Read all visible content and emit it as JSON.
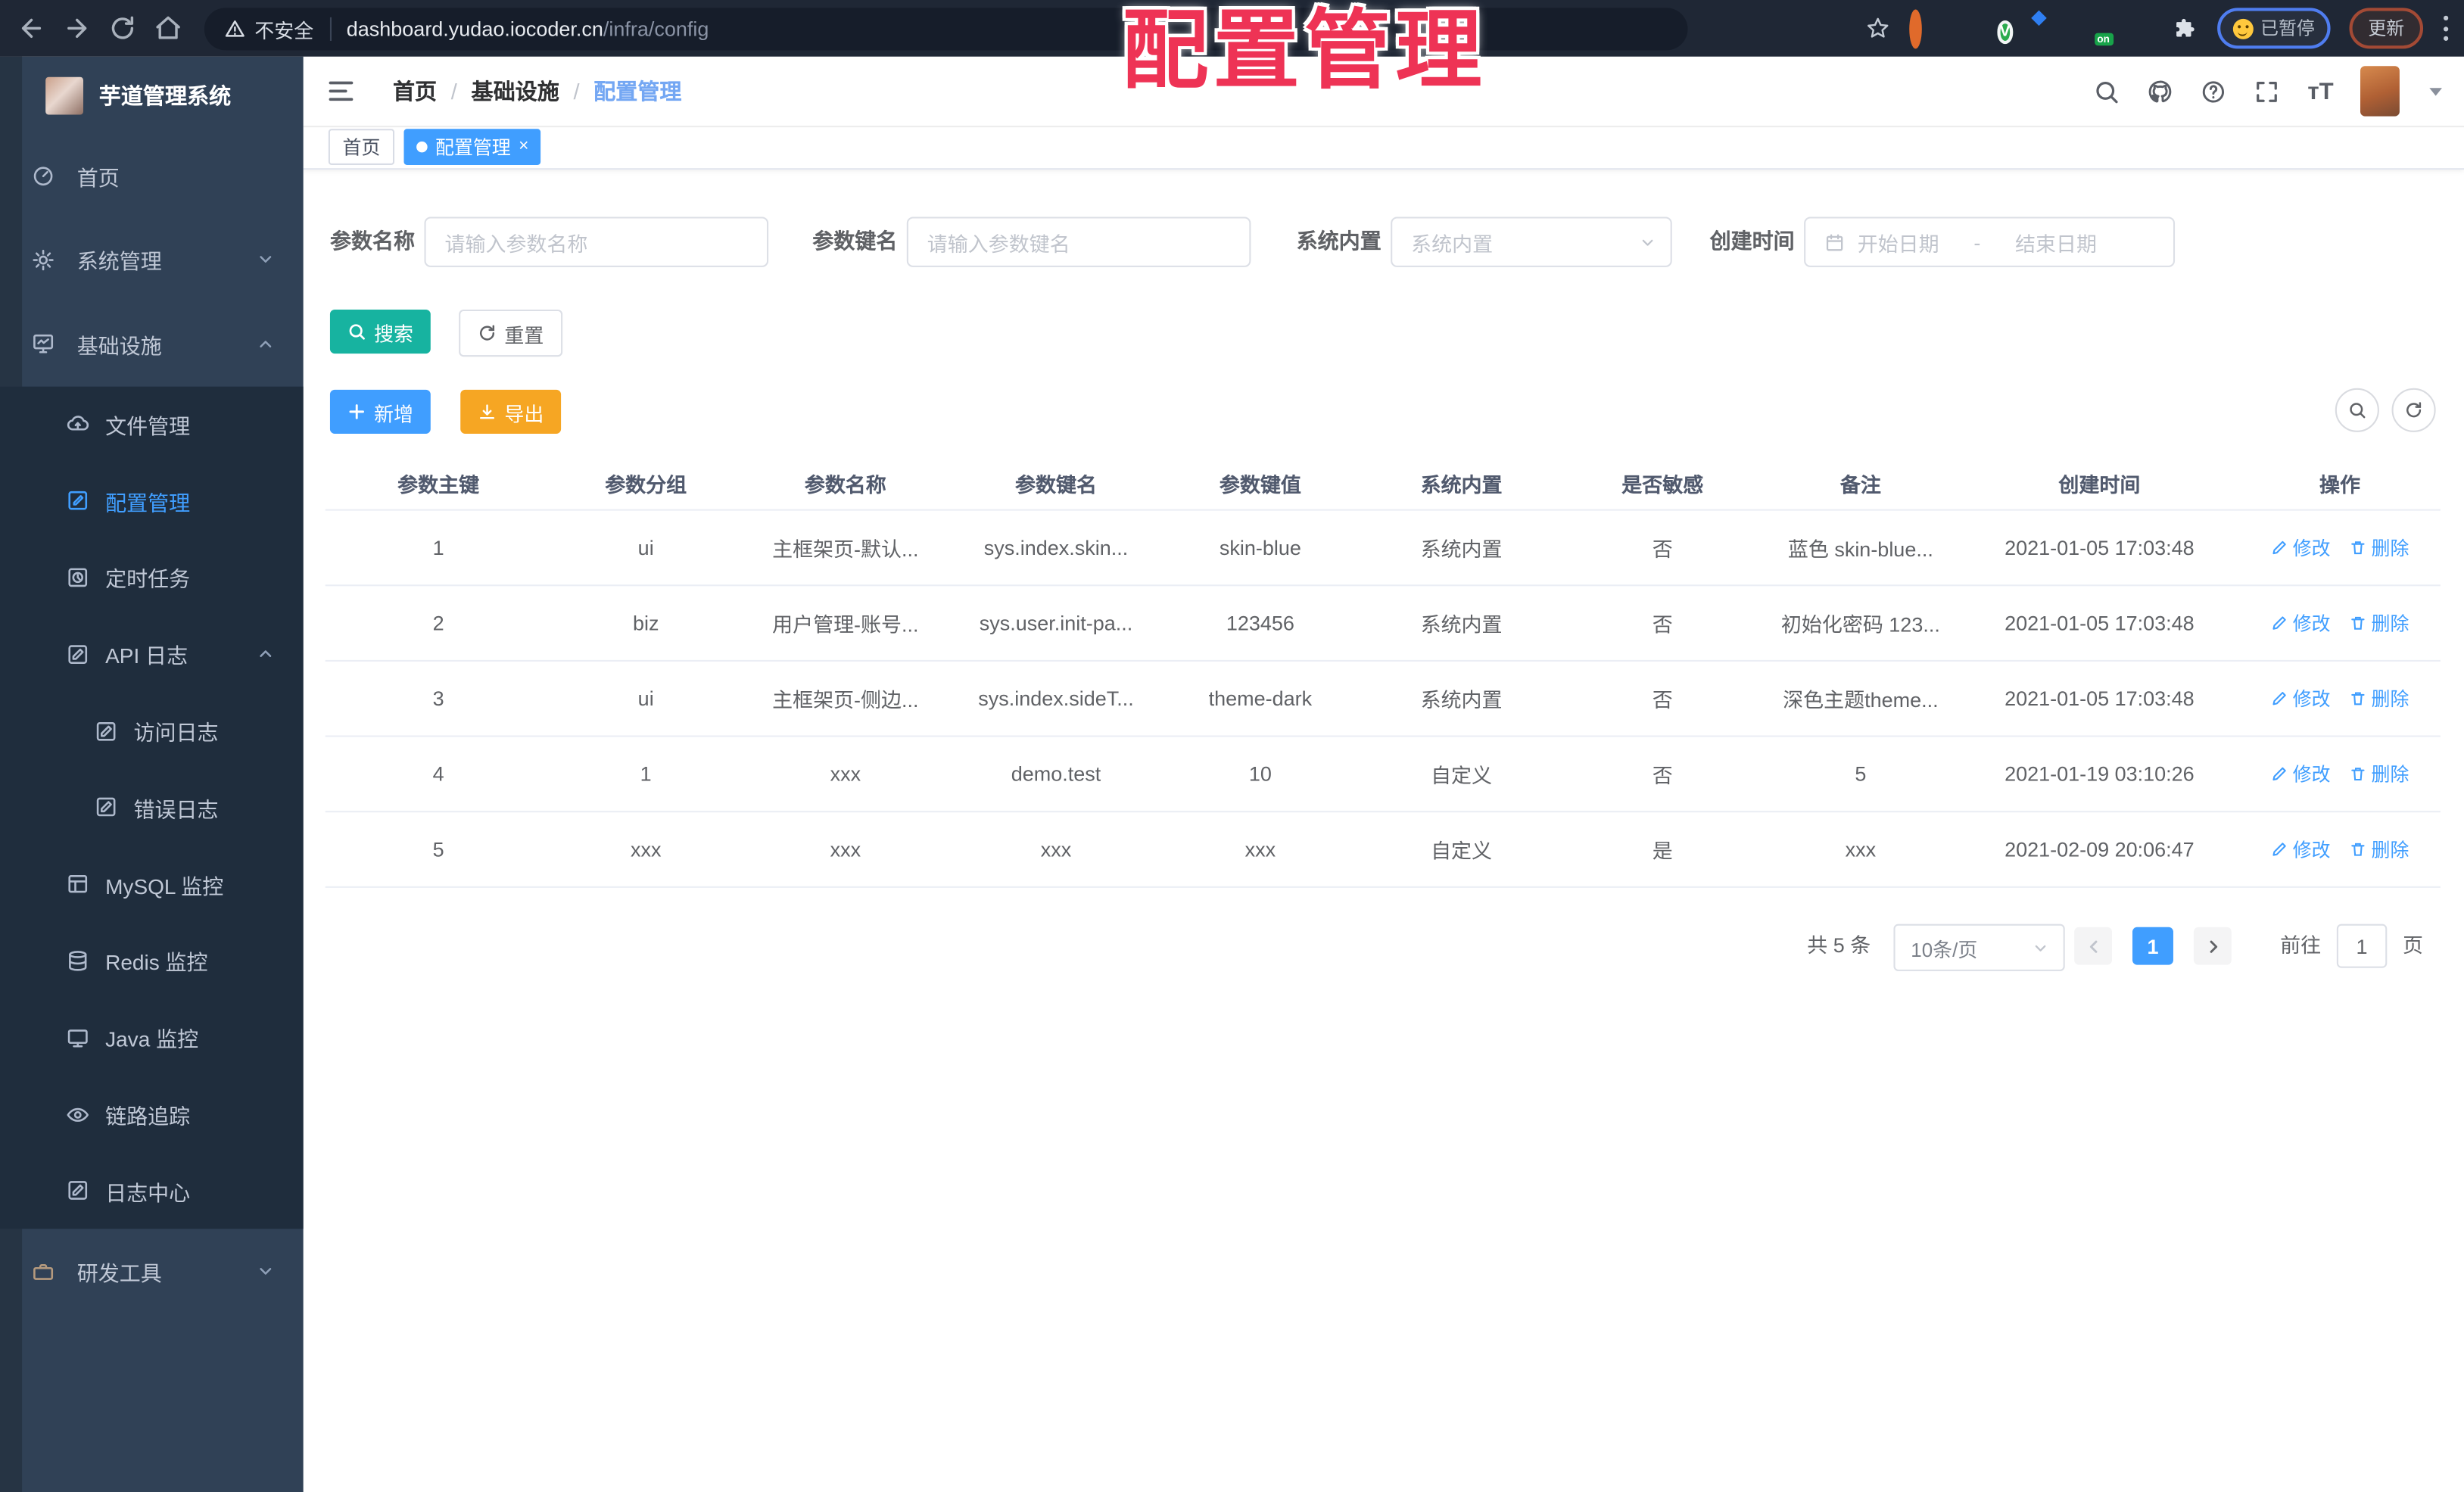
{
  "browser": {
    "security": "不安全",
    "host": "dashboard.yudao.iocoder.cn",
    "path": "/infra/config",
    "paused": "已暂停",
    "update": "更新",
    "on_badge": "on"
  },
  "watermark": "配置管理",
  "sidebar": {
    "title": "芋道管理系统",
    "items": [
      {
        "label": "首页"
      },
      {
        "label": "系统管理"
      },
      {
        "label": "基础设施"
      },
      {
        "label": "文件管理"
      },
      {
        "label": "配置管理"
      },
      {
        "label": "定时任务"
      },
      {
        "label": "API 日志"
      },
      {
        "label": "访问日志"
      },
      {
        "label": "错误日志"
      },
      {
        "label": "MySQL 监控"
      },
      {
        "label": "Redis 监控"
      },
      {
        "label": "Java 监控"
      },
      {
        "label": "链路追踪"
      },
      {
        "label": "日志中心"
      },
      {
        "label": "研发工具"
      }
    ]
  },
  "breadcrumb": {
    "items": [
      "首页",
      "基础设施",
      "配置管理"
    ],
    "sep": "/"
  },
  "tags": {
    "home": "首页",
    "active": "配置管理",
    "close": "×"
  },
  "filters": {
    "name_label": "参数名称",
    "name_placeholder": "请输入参数名称",
    "key_label": "参数键名",
    "key_placeholder": "请输入参数键名",
    "type_label": "系统内置",
    "type_placeholder": "系统内置",
    "date_label": "创建时间",
    "date_start": "开始日期",
    "date_sep": "-",
    "date_end": "结束日期",
    "search": "搜索",
    "reset": "重置"
  },
  "toolbar": {
    "add": "新增",
    "export": "导出"
  },
  "table": {
    "headers": [
      "参数主键",
      "参数分组",
      "参数名称",
      "参数键名",
      "参数键值",
      "系统内置",
      "是否敏感",
      "备注",
      "创建时间",
      "操作"
    ],
    "edit": "修改",
    "delete": "删除",
    "rows": [
      [
        "1",
        "ui",
        "主框架页-默认...",
        "sys.index.skin...",
        "skin-blue",
        "系统内置",
        "否",
        "蓝色 skin-blue...",
        "2021-01-05 17:03:48"
      ],
      [
        "2",
        "biz",
        "用户管理-账号...",
        "sys.user.init-pa...",
        "123456",
        "系统内置",
        "否",
        "初始化密码 123...",
        "2021-01-05 17:03:48"
      ],
      [
        "3",
        "ui",
        "主框架页-侧边...",
        "sys.index.sideT...",
        "theme-dark",
        "系统内置",
        "否",
        "深色主题theme...",
        "2021-01-05 17:03:48"
      ],
      [
        "4",
        "1",
        "xxx",
        "demo.test",
        "10",
        "自定义",
        "否",
        "5",
        "2021-01-19 03:10:26"
      ],
      [
        "5",
        "xxx",
        "xxx",
        "xxx",
        "xxx",
        "自定义",
        "是",
        "xxx",
        "2021-02-09 20:06:47"
      ]
    ]
  },
  "pagination": {
    "total": "共 5 条",
    "size": "10条/页",
    "page": "1",
    "goto": "前往",
    "unit": "页",
    "input": "1"
  }
}
